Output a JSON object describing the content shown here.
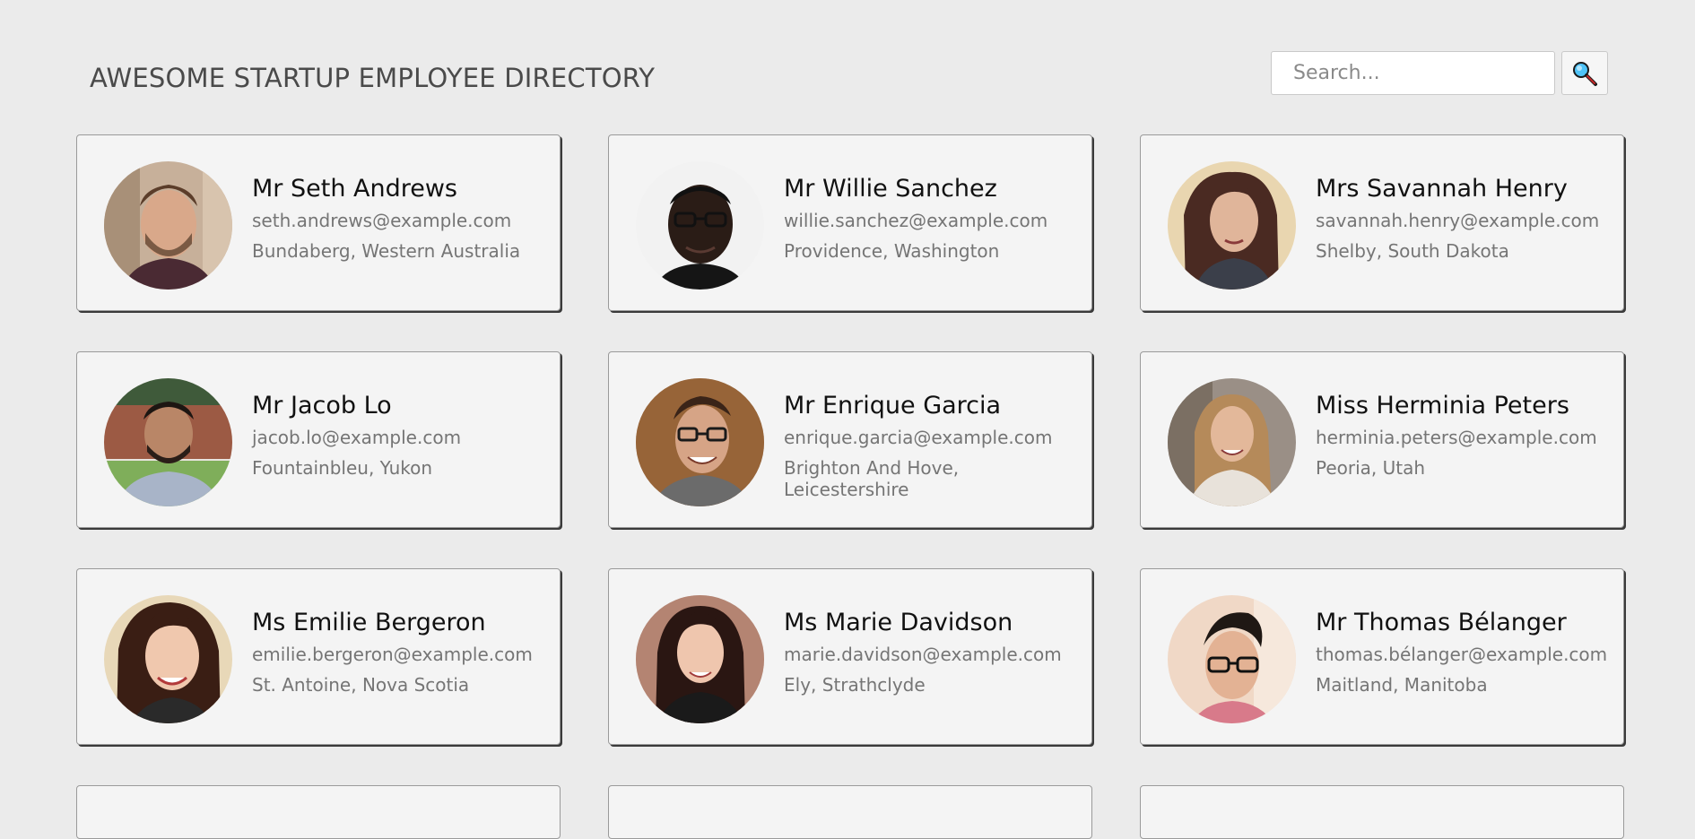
{
  "header": {
    "title": "AWESOME STARTUP EMPLOYEE DIRECTORY",
    "search_placeholder": "Search...",
    "search_button_icon": "magnifier-icon"
  },
  "employees": [
    {
      "name": "Mr Seth Andrews",
      "email": "seth.andrews@example.com",
      "location": "Bundaberg, Western Australia"
    },
    {
      "name": "Mr Willie Sanchez",
      "email": "willie.sanchez@example.com",
      "location": "Providence, Washington"
    },
    {
      "name": "Mrs Savannah Henry",
      "email": "savannah.henry@example.com",
      "location": "Shelby, South Dakota"
    },
    {
      "name": "Mr Jacob Lo",
      "email": "jacob.lo@example.com",
      "location": "Fountainbleu, Yukon"
    },
    {
      "name": "Mr Enrique Garcia",
      "email": "enrique.garcia@example.com",
      "location": "Brighton And Hove, Leicestershire"
    },
    {
      "name": "Miss Herminia Peters",
      "email": "herminia.peters@example.com",
      "location": "Peoria, Utah"
    },
    {
      "name": "Ms Emilie Bergeron",
      "email": "emilie.bergeron@example.com",
      "location": "St. Antoine, Nova Scotia"
    },
    {
      "name": "Ms Marie Davidson",
      "email": "marie.davidson@example.com",
      "location": "Ely, Strathclyde"
    },
    {
      "name": "Mr Thomas Bélanger",
      "email": "thomas.bélanger@example.com",
      "location": "Maitland, Manitoba"
    }
  ],
  "colors": {
    "background": "#ebebeb",
    "card": "#f4f4f4",
    "text_primary": "#111111",
    "text_secondary": "#757575",
    "title": "#4a4a4a"
  }
}
